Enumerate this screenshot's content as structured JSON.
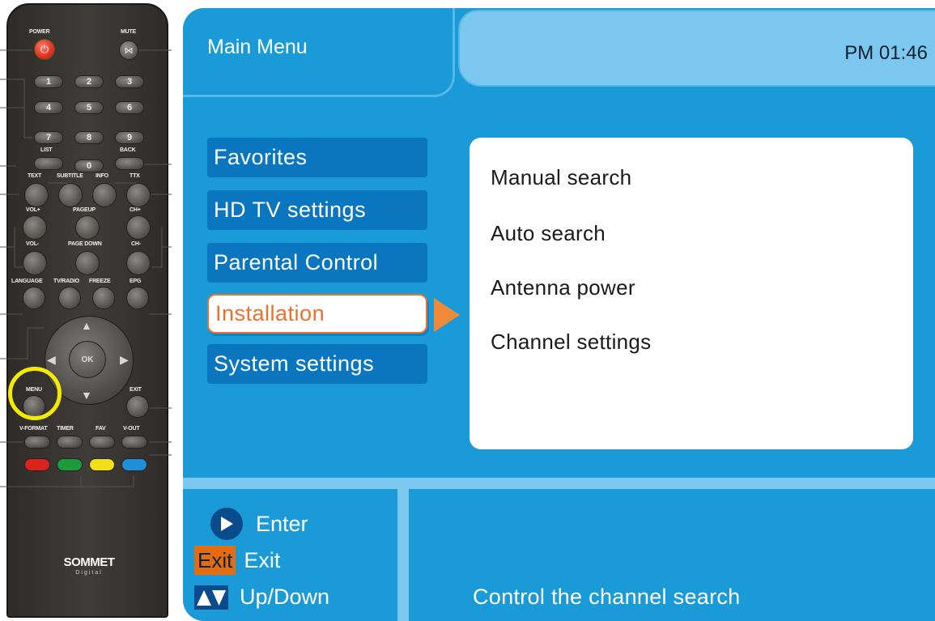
{
  "remote": {
    "power_label": "POWER",
    "mute_label": "MUTE",
    "digits": [
      "1",
      "2",
      "3",
      "4",
      "5",
      "6",
      "7",
      "8",
      "9",
      "0"
    ],
    "list_label": "LIST",
    "back_label": "BACK",
    "text_label": "TEXT",
    "subtitle_label": "SUBTITLE",
    "info_label": "INFO",
    "ttx_label": "TTX",
    "volup_label": "VOL+",
    "pageup_label": "PAGEUP",
    "chup_label": "CH+",
    "voldown_label": "VOL-",
    "pagedown_label": "PAGE DOWN",
    "chdown_label": "CH-",
    "language_label": "LANGUAGE",
    "tvradio_label": "TV/RADIO",
    "freeze_label": "FREEZE",
    "epg_label": "EPG",
    "ok_label": "OK",
    "menu_label": "MENU",
    "exit_label": "EXIT",
    "vformat_label": "V-FORMAT",
    "timer_label": "TIMER",
    "fav_label": "FAV",
    "vout_label": "V-OUT",
    "brand": "SOMMET",
    "brand_sub": "Digital",
    "color_buttons": [
      "#d8231f",
      "#1d9a3b",
      "#f2e016",
      "#1f8fd8"
    ]
  },
  "screen": {
    "title": "Main Menu",
    "clock": "PM 01:46",
    "menu_items": [
      "Favorites",
      "HD TV settings",
      "Parental Control",
      "Installation",
      "System settings"
    ],
    "selected_index": 3,
    "submenu_items": [
      "Manual search",
      "Auto  search",
      "Antenna power",
      "Channel settings"
    ],
    "legend": {
      "enter_label": "Enter",
      "exit_badge": "Exit",
      "exit_label": "Exit",
      "updown_label": "Up/Down"
    },
    "help_text": "Control the channel search",
    "colors": {
      "background": "#1b9ad8",
      "menu_item": "#0a76bf",
      "highlight": "#e8722e",
      "accent_light": "#7cc7ef"
    }
  }
}
